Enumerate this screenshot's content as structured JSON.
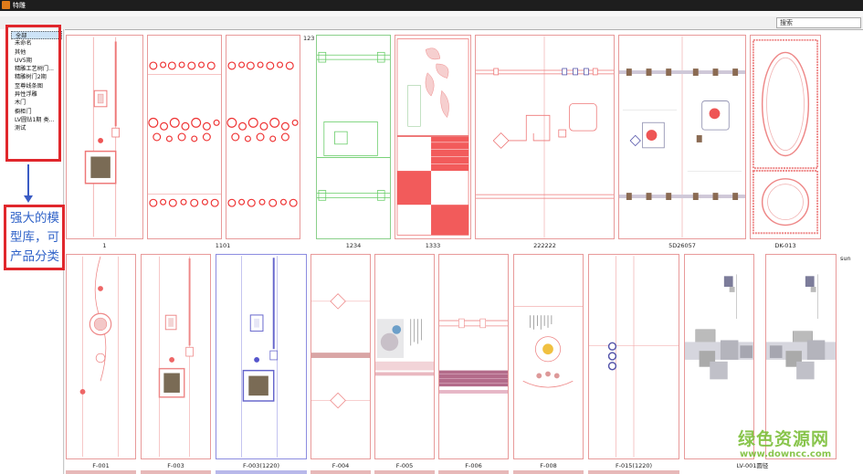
{
  "window": {
    "title": "特雕"
  },
  "search": {
    "text": "搜索"
  },
  "sidebar": {
    "items": [
      {
        "label": "全部",
        "selected": true
      },
      {
        "label": "未命名"
      },
      {
        "label": "其他"
      },
      {
        "label": "UV5期"
      },
      {
        "label": "精雕工艺树门..."
      },
      {
        "label": "精雕树门2期"
      },
      {
        "label": "至尊线条图"
      },
      {
        "label": "异性浮雕"
      },
      {
        "label": "木门"
      },
      {
        "label": "橱柜门"
      },
      {
        "label": "LV圆钻1期   类..."
      },
      {
        "label": "测试"
      }
    ]
  },
  "callout": {
    "text": "强大的模型库，可产品分类"
  },
  "gallery": {
    "row1": [
      {
        "label": "1"
      },
      {
        "label": "1101"
      },
      {
        "label": "1234"
      },
      {
        "label": "1333"
      },
      {
        "label": "222222"
      },
      {
        "label": "5D26057"
      },
      {
        "label": "DK-013"
      }
    ],
    "row1_corner": "123",
    "row2": [
      {
        "label": "F-001"
      },
      {
        "label": "F-003"
      },
      {
        "label": "F-003(1220)"
      },
      {
        "label": "F-004"
      },
      {
        "label": "F-005"
      },
      {
        "label": "F-006"
      },
      {
        "label": "F-008"
      },
      {
        "label": "F-015(1220)"
      },
      {
        "label": "LV-001圆径"
      }
    ],
    "row2_corner": "sun"
  },
  "watermark": {
    "line1": "绿色资源网",
    "line2": "www.downcc.com"
  },
  "colors": {
    "accent_red": "#e0272c",
    "callout_text": "#2f62c8",
    "selection": "#cde3f7",
    "watermark": "#7dbf3a"
  }
}
